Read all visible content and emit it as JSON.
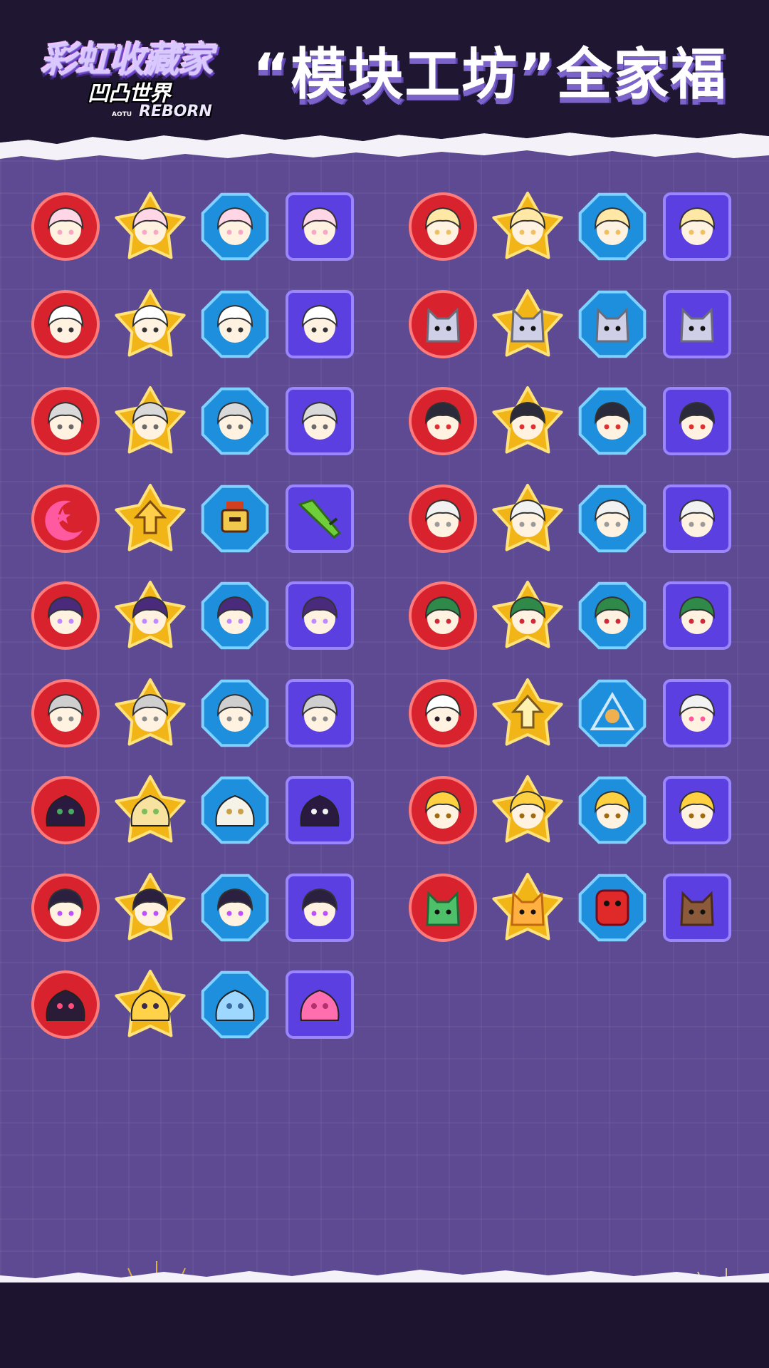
{
  "header": {
    "logo_text": "彩虹收藏家",
    "logo_sub": "凹凸世界",
    "logo_small": "AOTU",
    "logo_reborn": "REBORN",
    "title": "“模块工坊”全家福"
  },
  "colors": {
    "background": "#5d4a92",
    "header": "#1f1631",
    "circle_badge": "#d8232f",
    "star_badge": "#f2b518",
    "octagon_badge": "#1e8fdc",
    "square_badge": "#5b3fe0"
  },
  "badge_shapes": [
    "circle",
    "star",
    "octagon",
    "square"
  ],
  "groups": [
    {
      "name": "left",
      "rows": [
        {
          "icons": [
            "pink-flower-hair-icon",
            "pink-flower-hair-icon",
            "pink-flower-hair-icon",
            "pink-flower-hair-icon"
          ]
        },
        {
          "icons": [
            "white-spiky-face-icon",
            "white-spiky-face-icon",
            "white-spiky-face-icon",
            "white-spiky-face-icon"
          ]
        },
        {
          "icons": [
            "pixel-grey-hair-icon",
            "pixel-grey-hair-icon",
            "pixel-grey-hair-icon",
            "pixel-grey-hair-icon"
          ]
        },
        {
          "icons": [
            "moon-star-icon",
            "arrow-up-icon",
            "helmet-icon",
            "green-sword-icon"
          ]
        },
        {
          "icons": [
            "purple-ghost-icon",
            "purple-ghost-icon",
            "purple-ghost-icon",
            "purple-ghost-icon"
          ]
        },
        {
          "icons": [
            "grey-spiky-icon",
            "grey-spiky-icon",
            "grey-spiky-icon",
            "grey-spiky-icon"
          ]
        },
        {
          "icons": [
            "dark-blob-hat-icon",
            "yellow-blob-icon",
            "white-sheep-icon",
            "dark-blob-scarf-icon"
          ]
        },
        {
          "icons": [
            "dark-hooded-icon",
            "dark-hooded-icon",
            "dark-hooded-icon",
            "dark-hooded-icon"
          ]
        },
        {
          "icons": [
            "dark-slime-icon",
            "yellow-slime-icon",
            "blue-slime-icon",
            "pink-slime-icon"
          ]
        }
      ]
    },
    {
      "name": "right",
      "rows": [
        {
          "icons": [
            "blonde-girl-icon",
            "blonde-girl-icon",
            "blonde-girl-icon",
            "blonde-girl-icon"
          ]
        },
        {
          "icons": [
            "cat-ear-cap-icon",
            "cat-ear-cap-icon",
            "cat-ear-cap-icon",
            "cat-ear-cap-icon"
          ]
        },
        {
          "icons": [
            "red-hat-boy-icon",
            "red-hat-boy-icon",
            "red-hat-boy-icon",
            "red-hat-boy-icon"
          ]
        },
        {
          "icons": [
            "pixel-white-hair-icon",
            "pixel-white-hair-icon",
            "pixel-white-hair-icon",
            "pixel-white-hair-icon"
          ]
        },
        {
          "icons": [
            "green-cap-masked-icon",
            "green-cap-masked-icon",
            "green-cap-masked-icon",
            "green-cap-masked-icon"
          ]
        },
        {
          "icons": [
            "crimson-face-icon",
            "arrow-star-icon",
            "triangle-gem-icon",
            "pink-glasses-icon"
          ]
        },
        {
          "icons": [
            "yellow-hair-boy-icon",
            "yellow-hair-boy-icon",
            "yellow-hair-boy-icon",
            "yellow-hair-boy-icon"
          ]
        },
        {
          "icons": [
            "green-cat-icon",
            "orange-cat-icon",
            "red-cube-icon",
            "brown-cat-icon"
          ]
        }
      ]
    }
  ]
}
